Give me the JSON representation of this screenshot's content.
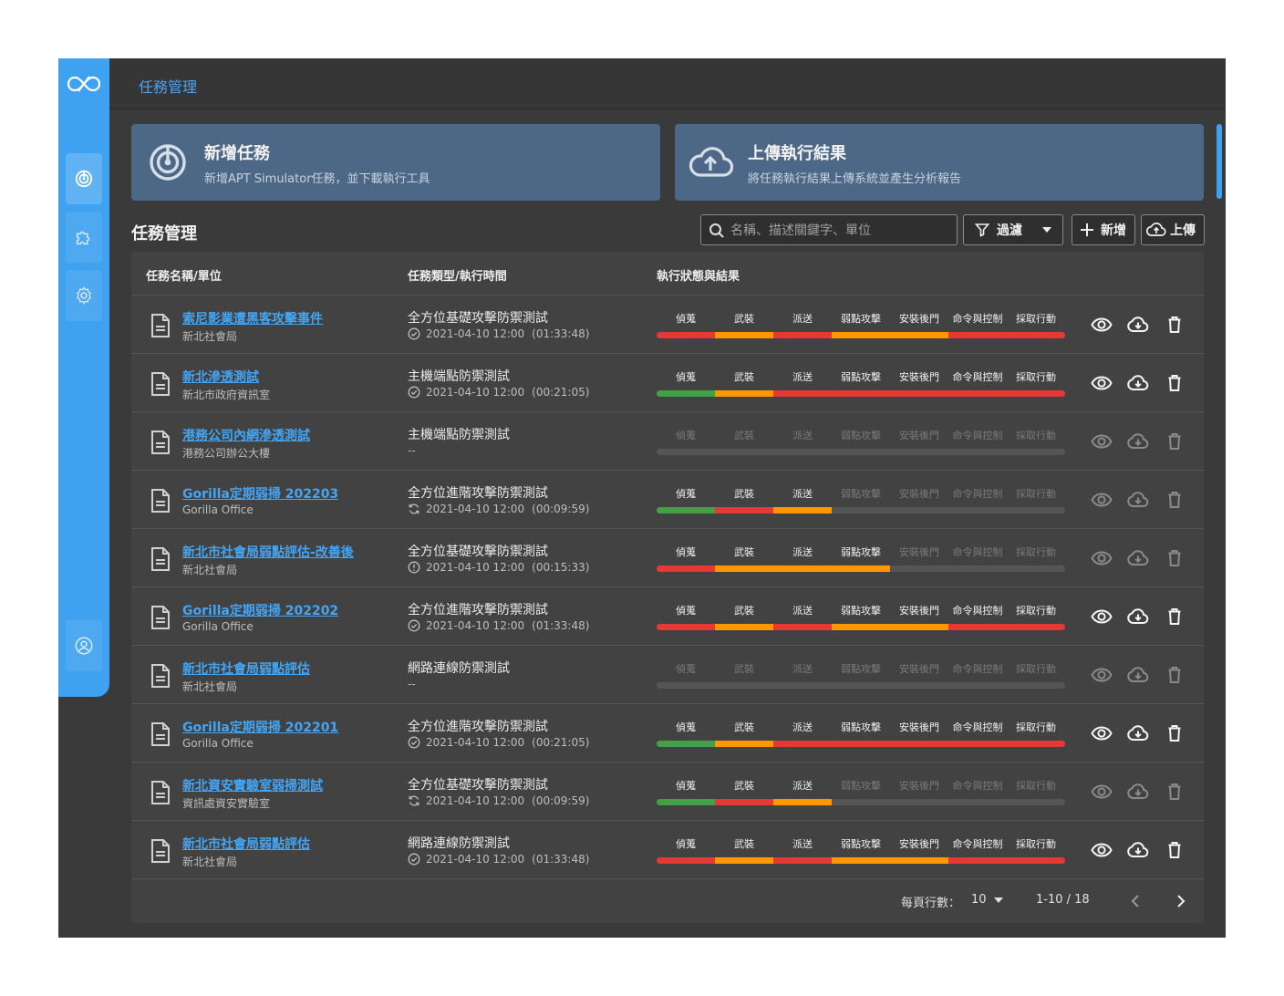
{
  "app": {
    "breadcrumb": "任務管理"
  },
  "sidebar": {
    "items": [
      {
        "icon": "radar-icon",
        "active": true
      },
      {
        "icon": "puzzle-icon",
        "active": false
      },
      {
        "icon": "gear-icon",
        "active": false
      },
      {
        "icon": "user-icon",
        "active": false
      }
    ]
  },
  "cards": [
    {
      "title": "新增任務",
      "subtitle": "新增APT Simulator任務，並下載執行工具",
      "icon": "radar-icon"
    },
    {
      "title": "上傳執行結果",
      "subtitle": "將任務執行結果上傳系統並產生分析報告",
      "icon": "cloud-upload-icon"
    }
  ],
  "toolbar": {
    "title": "任務管理",
    "search_placeholder": "名稱、描述關鍵字、單位",
    "filter_label": "過濾",
    "add_label": "新增",
    "upload_label": "上傳"
  },
  "table": {
    "headers": [
      "任務名稱/單位",
      "任務類型/執行時間",
      "執行狀態與結果"
    ],
    "stages": [
      "偵蒐",
      "武裝",
      "派送",
      "弱點攻擊",
      "安裝後門",
      "命令與控制",
      "採取行動"
    ],
    "rows": [
      {
        "name": "索尼影業遭黑客攻擊事件",
        "unit": "新北社會局",
        "type": "全方位基礎攻擊防禦測試",
        "status_icon": "check-circle",
        "time": "2021-04-10 12:00",
        "duration": "(01:33:48)",
        "progress": 7,
        "colors": [
          "#e53935",
          "#ff9800",
          "#e53935",
          "#ff9800",
          "#ff9800",
          "#e53935",
          "#e53935"
        ],
        "actions_enabled": true
      },
      {
        "name": "新北滲透測試",
        "unit": "新北市政府資訊室",
        "type": "主機端點防禦測試",
        "status_icon": "check-circle",
        "time": "2021-04-10 12:00",
        "duration": "(00:21:05)",
        "progress": 7,
        "colors": [
          "#43a047",
          "#ff9800",
          "#e53935",
          "#e53935",
          "#e53935",
          "#e53935",
          "#e53935"
        ],
        "actions_enabled": true
      },
      {
        "name": "港務公司內網滲透測試",
        "unit": "港務公司辦公大樓",
        "type": "主機端點防禦測試",
        "status_icon": "",
        "time": "--",
        "duration": "",
        "progress": 0,
        "colors": [],
        "actions_enabled": false
      },
      {
        "name": "Gorilla定期弱掃 202203",
        "unit": "Gorilla Office",
        "type": "全方位進階攻擊防禦測試",
        "status_icon": "sync",
        "time": "2021-04-10 12:00",
        "duration": "(00:09:59)",
        "progress": 3,
        "colors": [
          "#43a047",
          "#e53935",
          "#ff9800"
        ],
        "actions_enabled": false
      },
      {
        "name": "新北市社會局弱點評估-改善後",
        "unit": "新北社會局",
        "type": "全方位基礎攻擊防禦測試",
        "status_icon": "alert-circle",
        "time": "2021-04-10 12:00",
        "duration": "(00:15:33)",
        "progress": 4,
        "colors": [
          "#e53935",
          "#ff9800",
          "#ff9800",
          "#ff9800"
        ],
        "actions_enabled": false
      },
      {
        "name": "Gorilla定期弱掃 202202",
        "unit": "Gorilla Office",
        "type": "全方位進階攻擊防禦測試",
        "status_icon": "check-circle",
        "time": "2021-04-10 12:00",
        "duration": "(01:33:48)",
        "progress": 7,
        "colors": [
          "#e53935",
          "#ff9800",
          "#e53935",
          "#ff9800",
          "#ff9800",
          "#e53935",
          "#e53935"
        ],
        "actions_enabled": true
      },
      {
        "name": "新北市社會局弱點評估",
        "unit": "新北社會局",
        "type": "網路連線防禦測試",
        "status_icon": "",
        "time": "--",
        "duration": "",
        "progress": 0,
        "colors": [],
        "actions_enabled": false
      },
      {
        "name": "Gorilla定期弱掃 202201",
        "unit": "Gorilla Office",
        "type": "全方位進階攻擊防禦測試",
        "status_icon": "check-circle",
        "time": "2021-04-10 12:00",
        "duration": "(00:21:05)",
        "progress": 7,
        "colors": [
          "#43a047",
          "#ff9800",
          "#e53935",
          "#e53935",
          "#e53935",
          "#e53935",
          "#e53935"
        ],
        "actions_enabled": true
      },
      {
        "name": "新北資安實驗室弱掃測試",
        "unit": "資訊處資安實驗室",
        "type": "全方位基礎攻擊防禦測試",
        "status_icon": "sync",
        "time": "2021-04-10 12:00",
        "duration": "(00:09:59)",
        "progress": 3,
        "colors": [
          "#43a047",
          "#e53935",
          "#ff9800"
        ],
        "actions_enabled": false
      },
      {
        "name": "新北市社會局弱點評估",
        "unit": "新北社會局",
        "type": "網路連線防禦測試",
        "status_icon": "check-circle",
        "time": "2021-04-10 12:00",
        "duration": "(01:33:48)",
        "progress": 7,
        "colors": [
          "#e53935",
          "#ff9800",
          "#e53935",
          "#ff9800",
          "#ff9800",
          "#e53935",
          "#e53935"
        ],
        "actions_enabled": true
      }
    ]
  },
  "pagination": {
    "rows_per_page_label": "每頁行數：",
    "rows_per_page": "10",
    "range": "1-10 / 18"
  },
  "colors": {
    "accent": "#3fa2f0",
    "link": "#42a5f5",
    "success": "#43a047",
    "warning": "#ff9800",
    "danger": "#e53935"
  }
}
